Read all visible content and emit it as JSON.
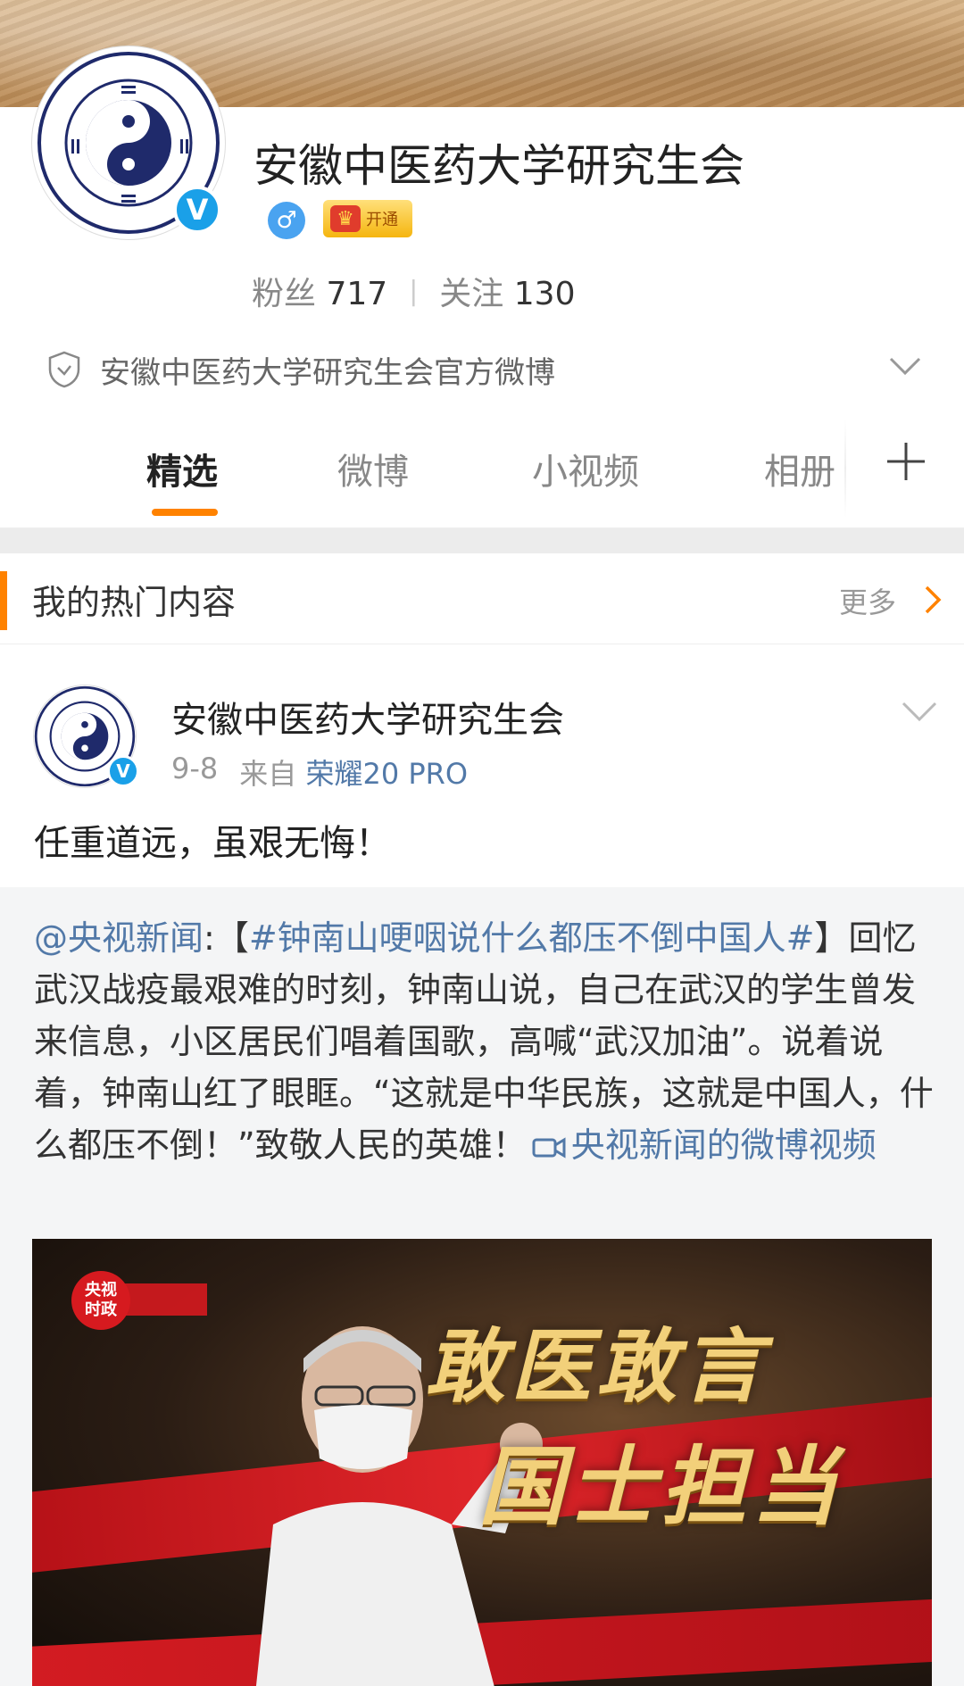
{
  "profile": {
    "name": "安徽中医药大学研究生会",
    "gender_symbol": "♂",
    "vip_label": "开通",
    "fans_label": "粉丝",
    "fans_count": "717",
    "follow_label": "关注",
    "follow_count": "130",
    "separator": "|",
    "description": "安徽中医药大学研究生会官方微博"
  },
  "tabs": [
    {
      "label": "精选",
      "active": true
    },
    {
      "label": "微博",
      "active": false
    },
    {
      "label": "小视频",
      "active": false
    },
    {
      "label": "相册",
      "active": false
    }
  ],
  "hot_section": {
    "title": "我的热门内容",
    "more_label": "更多"
  },
  "post": {
    "author": "安徽中医药大学研究生会",
    "date": "9-8",
    "from_label": "来自",
    "source": "荣耀20 PRO",
    "text": "任重道远，虽艰无悔！",
    "repost": {
      "mention": "@央视新闻",
      "colon": ":【",
      "hashtag": "#钟南山哽咽说什么都压不倒中国人#",
      "bracket_close": "】",
      "body": "回忆武汉战疫最艰难的时刻，钟南山说，自己在武汉的学生曾发来信息，小区居民们唱着国歌，高喊“武汉加油”。说着说着，钟南山红了眼眶。“这就是中华民族，这就是中国人，什么都压不倒！”致敬人民的英雄！",
      "video_link": "央视新闻的微博视频"
    },
    "video": {
      "badge_line1": "央视",
      "badge_line2": "时政",
      "title_line1": "敢医敢言",
      "title_line2": "国士担当"
    }
  },
  "colors": {
    "accent": "#ff8200",
    "link": "#5279a8",
    "verified": "#1aa0e8"
  }
}
